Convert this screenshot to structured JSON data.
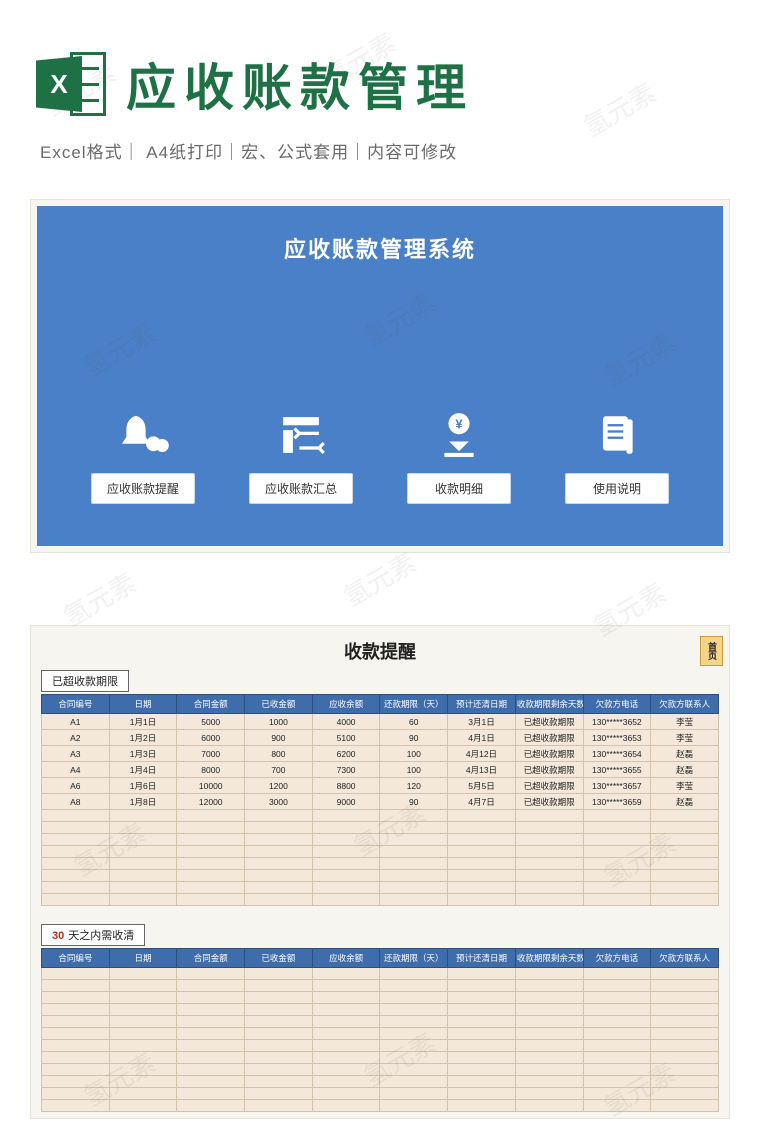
{
  "watermark": "氢元素",
  "header": {
    "excel_x": "X",
    "title": "应收账款管理",
    "subtitle": "Excel格式｜ A4纸打印｜宏、公式套用｜内容可修改"
  },
  "dashboard": {
    "title": "应收账款管理系统",
    "items": [
      {
        "label": "应收账款提醒"
      },
      {
        "label": "应收账款汇总"
      },
      {
        "label": "收款明细"
      },
      {
        "label": "使用说明"
      }
    ]
  },
  "sheet": {
    "title": "收款提醒",
    "home_tab": "首页",
    "section1_tag": "已超收款期限",
    "section2_prefix": "30",
    "section2_rest": "天之内需收清",
    "columns": [
      "合同编号",
      "日期",
      "合同金额",
      "已收金额",
      "应收余额",
      "还款期限（天）",
      "预计还清日期",
      "收款期限剩余天数",
      "欠款方电话",
      "欠款方联系人"
    ],
    "rows": [
      [
        "A1",
        "1月1日",
        "5000",
        "1000",
        "4000",
        "60",
        "3月1日",
        "已超收款期限",
        "130*****3652",
        "李莹"
      ],
      [
        "A2",
        "1月2日",
        "6000",
        "900",
        "5100",
        "90",
        "4月1日",
        "已超收款期限",
        "130*****3653",
        "李莹"
      ],
      [
        "A3",
        "1月3日",
        "7000",
        "800",
        "6200",
        "100",
        "4月12日",
        "已超收款期限",
        "130*****3654",
        "赵磊"
      ],
      [
        "A4",
        "1月4日",
        "8000",
        "700",
        "7300",
        "100",
        "4月13日",
        "已超收款期限",
        "130*****3655",
        "赵磊"
      ],
      [
        "A6",
        "1月6日",
        "10000",
        "1200",
        "8800",
        "120",
        "5月5日",
        "已超收款期限",
        "130*****3657",
        "李莹"
      ],
      [
        "A8",
        "1月8日",
        "12000",
        "3000",
        "9000",
        "90",
        "4月7日",
        "已超收款期限",
        "130*****3659",
        "赵磊"
      ]
    ]
  }
}
